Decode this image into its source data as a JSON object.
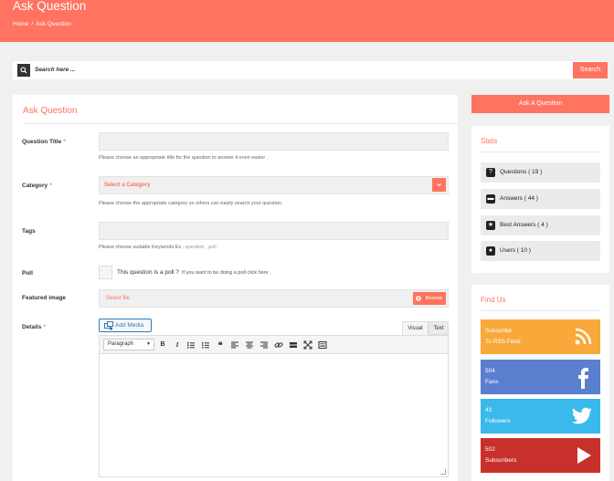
{
  "hero": {
    "title": "Ask Question",
    "breadcrumb": {
      "home": "Home",
      "separator": "/",
      "current": "Ask Question"
    }
  },
  "search": {
    "placeholder": "Search here ...",
    "button": "Search"
  },
  "form": {
    "heading": "Ask Question",
    "question_title": {
      "label": "Question Title",
      "required": "*",
      "value": "",
      "help": "Please choose an appropriate title for the question to answer it even easier ."
    },
    "category": {
      "label": "Category",
      "required": "*",
      "selected": "Select a Category",
      "help": "Please choose the appropriate category so others can easily search your question."
    },
    "tags": {
      "label": "Tags",
      "value": "",
      "help": "Please choose suitable Keywords Ex :",
      "help_example": "question , poll ."
    },
    "poll": {
      "label": "Poll",
      "checked": false,
      "text": "This question is a poll ?",
      "hint": "If you want to be doing a poll click here ."
    },
    "featured_image": {
      "label": "Featured image",
      "file_text": "Select file",
      "browse": "Browse"
    },
    "details": {
      "label": "Details",
      "required": "*",
      "add_media": "Add Media",
      "tabs": [
        "Visual",
        "Text"
      ],
      "active_tab": "Visual",
      "format": "Paragraph",
      "toolbar_icons": [
        "bold-icon",
        "italic-icon",
        "bullet-list-icon",
        "numbered-list-icon",
        "blockquote-icon",
        "align-left-icon",
        "align-center-icon",
        "align-right-icon",
        "link-icon",
        "read-more-icon",
        "fullscreen-icon",
        "toolbar-toggle-icon"
      ],
      "content": ""
    }
  },
  "sidebar": {
    "ask_button": "Ask A Question",
    "stats": {
      "heading": "Stats",
      "items": [
        {
          "label": "Questions ( 19 )",
          "icon": "question-icon"
        },
        {
          "label": "Answers ( 44 )",
          "icon": "comment-icon"
        },
        {
          "label": "Best Answers ( 4 )",
          "icon": "star-icon"
        },
        {
          "label": "Users ( 10 )",
          "icon": "user-icon"
        }
      ]
    },
    "find_us": {
      "heading": "Find Us",
      "items": [
        {
          "line1": "Subscribe",
          "line2": "To RSS Feed",
          "icon": "rss-icon",
          "color": "#f8a939"
        },
        {
          "line1": "504",
          "line2": "Fans",
          "icon": "facebook-icon",
          "color": "#5a7fcf"
        },
        {
          "line1": "43",
          "line2": "Followers",
          "icon": "twitter-icon",
          "color": "#3ab9ec"
        },
        {
          "line1": "502",
          "line2": "Subscribers",
          "icon": "youtube-icon",
          "color": "#c8302c"
        }
      ]
    }
  },
  "colors": {
    "accent": "#ff7361",
    "page_bg": "#f0f0f0",
    "link_blue": "#2e7cb8"
  }
}
